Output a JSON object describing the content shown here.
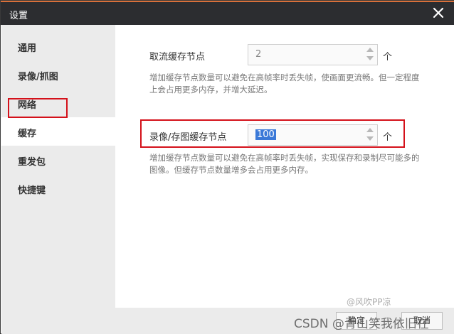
{
  "window": {
    "title": "设置"
  },
  "sidebar": {
    "items": [
      {
        "label": "通用"
      },
      {
        "label": "录像/抓图"
      },
      {
        "label": "网络"
      },
      {
        "label": "缓存"
      },
      {
        "label": "重发包"
      },
      {
        "label": "快捷键"
      }
    ],
    "active_index": 3
  },
  "cache": {
    "stream": {
      "label": "取流缓存节点",
      "value": "2",
      "unit": "个",
      "description": "增加缓存节点数量可以避免在高帧率时丢失帧，使画面更流畅。但一定程度上会占用更多内存，并增大延迟。"
    },
    "record": {
      "label": "录像/存图缓存节点",
      "value": "100",
      "unit": "个",
      "description": "增加缓存节点数量可以避免在高帧率时丢失帧，实现保存和录制尽可能多的图像。但缓存节点数量增多会占用更多内存。"
    }
  },
  "footer": {
    "ok_label": "确定",
    "cancel_label": "取消"
  },
  "watermarks": {
    "line1": "@风吹PP凉",
    "line2": "CSDN @青山笑我依旧在"
  },
  "colors": {
    "titlebar": "#2c2d30",
    "accent_border": "#d9703a",
    "highlight_box": "#d4111a",
    "selection": "#3b79d8"
  }
}
